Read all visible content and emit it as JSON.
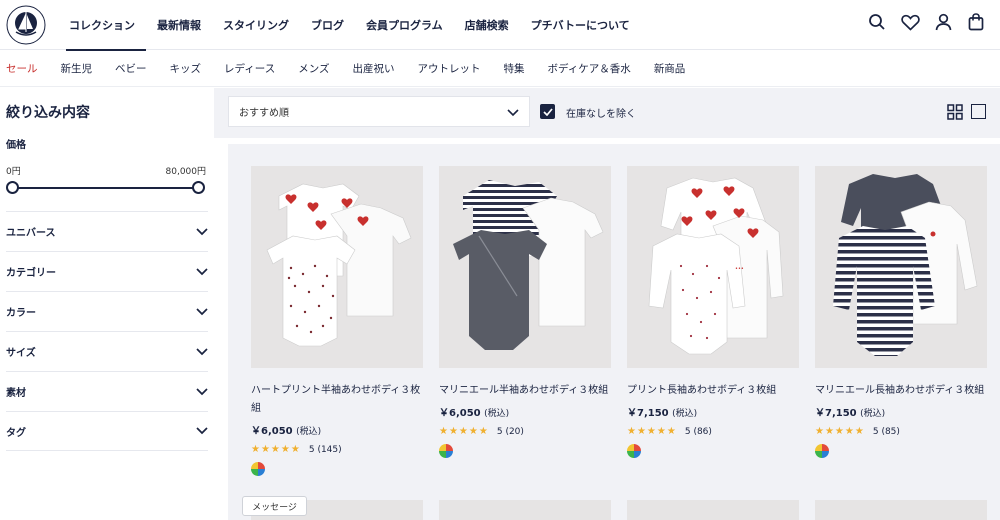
{
  "header": {
    "logo_text": "PETIT BATEAU",
    "nav": [
      "コレクション",
      "最新情報",
      "スタイリング",
      "ブログ",
      "会員プログラム",
      "店舗検索",
      "プチバトーについて"
    ],
    "icons": [
      "search-icon",
      "heart-icon",
      "user-icon",
      "bag-icon"
    ]
  },
  "subnav": [
    "セール",
    "新生児",
    "ベビー",
    "キッズ",
    "レディース",
    "メンズ",
    "出産祝い",
    "アウトレット",
    "特集",
    "ボディケア＆香水",
    "新商品"
  ],
  "sidebar": {
    "title": "絞り込み内容",
    "price_label": "価格",
    "price_min": "0円",
    "price_max": "80,000円",
    "facets": [
      "ユニバース",
      "カテゴリー",
      "カラー",
      "サイズ",
      "素材",
      "タグ"
    ]
  },
  "toolbar": {
    "sort_value": "おすすめ順",
    "stock_label": "在庫なしを除く",
    "stock_checked": true
  },
  "products": [
    {
      "name": "ハートプリント半袖あわせボディ３枚組",
      "price": "￥6,050",
      "tax": "(税込)",
      "stars": "★★★★★",
      "rating": "5",
      "reviews": "(145)"
    },
    {
      "name": "マリニエール半袖あわせボディ３枚組",
      "price": "￥6,050",
      "tax": "(税込)",
      "stars": "★★★★★",
      "rating": "5",
      "reviews": "(20)"
    },
    {
      "name": "プリント長袖あわせボディ３枚組",
      "price": "￥7,150",
      "tax": "(税込)",
      "stars": "★★★★★",
      "rating": "5",
      "reviews": "(86)"
    },
    {
      "name": "マリニエール長袖あわせボディ３枚組",
      "price": "￥7,150",
      "tax": "(税込)",
      "stars": "★★★★★",
      "rating": "5",
      "reviews": "(85)"
    }
  ],
  "message_tab": "メッセージ",
  "colors": {
    "navy": "#1a2340",
    "sale": "#c8302e",
    "star": "#f0b030",
    "panel": "#f1f2f6"
  }
}
